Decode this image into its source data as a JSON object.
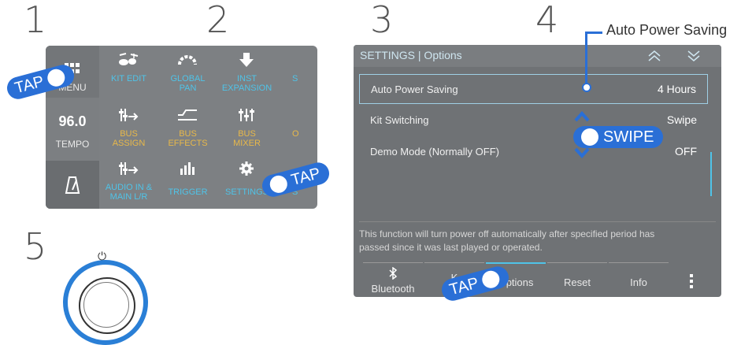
{
  "steps": [
    "1",
    "2",
    "3",
    "4",
    "5"
  ],
  "menu_panel": {
    "sidebar": {
      "menu_label": "MENU",
      "tempo_value": "96.0",
      "tempo_label": "TEMPO"
    },
    "items": [
      {
        "label_1": "KIT EDIT",
        "label_2": "",
        "icon": "drum-kit-icon",
        "color": "#4fc3e8"
      },
      {
        "label_1": "GLOBAL",
        "label_2": "PAN",
        "icon": "pan-arc-icon",
        "color": "#4fc3e8"
      },
      {
        "label_1": "INST",
        "label_2": "EXPANSION",
        "icon": "download-arrow-icon",
        "color": "#4fc3e8"
      },
      {
        "label_1": "S",
        "label_2": "",
        "icon": "",
        "color": "#4fc3e8"
      },
      {
        "label_1": "BUS",
        "label_2": "ASSIGN",
        "icon": "bus-assign-icon",
        "color": "#e8b84a"
      },
      {
        "label_1": "BUS",
        "label_2": "EFFECTS",
        "icon": "effects-curve-icon",
        "color": "#e8b84a"
      },
      {
        "label_1": "BUS",
        "label_2": "MIXER",
        "icon": "mixer-faders-icon",
        "color": "#e8b84a"
      },
      {
        "label_1": "O",
        "label_2": "",
        "icon": "",
        "color": "#e8b84a"
      },
      {
        "label_1": "AUDIO IN &",
        "label_2": "MAIN L/R",
        "icon": "audio-in-icon",
        "color": "#4fc3e8"
      },
      {
        "label_1": "TRIGGER",
        "label_2": "",
        "icon": "level-bars-icon",
        "color": "#4fc3e8"
      },
      {
        "label_1": "SETTINGS",
        "label_2": "",
        "icon": "gear-icon",
        "color": "#4fc3e8"
      },
      {
        "label_1": "S",
        "label_2": "",
        "icon": "",
        "color": "#4fc3e8"
      }
    ],
    "tap_menu": "TAP",
    "tap_settings": "TAP"
  },
  "settings_panel": {
    "title": "SETTINGS | Options",
    "rows": [
      {
        "label": "Auto Power Saving",
        "value": "4 Hours"
      },
      {
        "label": "Kit Switching",
        "value": "Swipe"
      },
      {
        "label": "Demo Mode (Normally OFF)",
        "value": "OFF"
      }
    ],
    "swipe_label": "SWIPE",
    "callout": "Auto Power Saving",
    "description_1": "This function will turn power off automatically after specified period has",
    "description_2": "passed since it was last played or operated.",
    "tabs": [
      "Bluetooth",
      "K",
      "Options",
      "Reset",
      "Info"
    ],
    "tap_options": "TAP",
    "bluetooth_icon": "bluetooth-icon",
    "more_icon": "more-vertical-icon"
  },
  "power_symbol": "⏻",
  "accent_blue": "#2a6fd6"
}
